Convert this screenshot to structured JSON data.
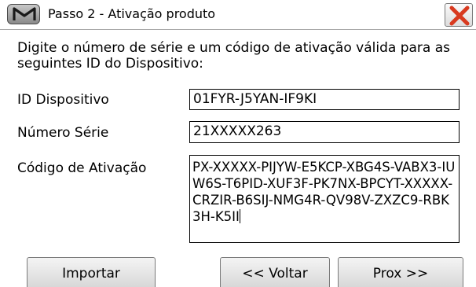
{
  "window": {
    "title": "Passo 2 - Ativação produto",
    "app_icon_name": "m-logo-icon",
    "close_icon_name": "close-icon",
    "close_color": "#d83a1f"
  },
  "instructions": "Digite o número de série e um código de ativação válida para as seguintes ID do Dispositivo:",
  "fields": {
    "device_id": {
      "label": "ID Dispositivo",
      "value": "01FYR-J5YAN-IF9KI"
    },
    "serial": {
      "label": "Número Série",
      "value": "21XXXXX263"
    },
    "activation": {
      "label": "Código de Ativação",
      "value": "PX-XXXXX-PIJYW-E5KCP-XBG4S-VABX3-IUW6S-T6PID-XUF3F-PK7NX-BPCYT-XXXXX-CRZIR-B6SIJ-NMG4R-QV98V-ZXZC9-RBK3H-K5II"
    }
  },
  "buttons": {
    "import": "Importar",
    "back": "<< Voltar",
    "next": "Prox >>"
  }
}
